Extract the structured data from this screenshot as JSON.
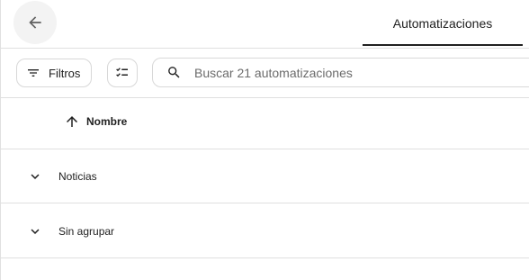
{
  "header": {
    "back_icon": "arrow-left-icon",
    "tab_label": "Automatizaciones"
  },
  "toolbar": {
    "filter_label": "Filtros",
    "filter_icon": "filter-list-icon",
    "select_icon": "checklist-icon",
    "search_icon": "search-icon",
    "search_placeholder": "Buscar 21 automatizaciones",
    "search_value": ""
  },
  "sort": {
    "label": "Nombre",
    "direction_icon": "arrow-up-icon"
  },
  "groups": [
    {
      "label": "Noticias",
      "icon": "chevron-down-icon"
    },
    {
      "label": "Sin agrupar",
      "icon": "chevron-down-icon"
    }
  ],
  "colors": {
    "divider": "#e0e0e0",
    "text": "#212121",
    "placeholder": "#6b6b6b",
    "back_button_bg": "#f3f3f3"
  }
}
